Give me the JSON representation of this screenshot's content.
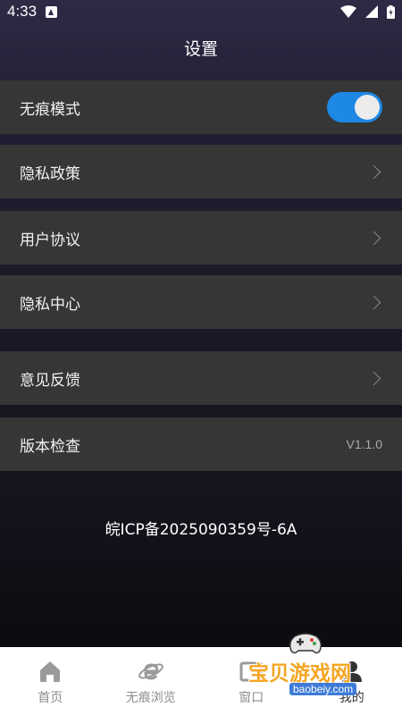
{
  "status_bar": {
    "time": "4:33"
  },
  "header": {
    "title": "设置"
  },
  "settings": {
    "incognito_mode": {
      "label": "无痕模式",
      "enabled": true
    },
    "privacy_policy": {
      "label": "隐私政策"
    },
    "user_agreement": {
      "label": "用户协议"
    },
    "privacy_center": {
      "label": "隐私中心"
    },
    "feedback": {
      "label": "意见反馈"
    },
    "version_check": {
      "label": "版本检查",
      "version": "V1.1.0"
    }
  },
  "icp": "皖ICP备2025090359号-6A",
  "bottom_nav": {
    "items": [
      {
        "label": "首页",
        "icon": "home-icon"
      },
      {
        "label": "无痕浏览",
        "icon": "browser-e-icon"
      },
      {
        "label": "窗口",
        "icon": "window-icon"
      },
      {
        "label": "我的",
        "icon": "profile-icon"
      }
    ]
  },
  "watermark": {
    "title": "宝贝游戏网",
    "url": "baobeiy.com"
  },
  "colors": {
    "accent": "#1e88e5",
    "row_bg": "#363636"
  }
}
